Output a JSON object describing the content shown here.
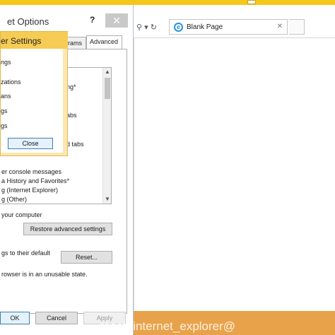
{
  "dialog": {
    "title": "et Options",
    "help": "?",
    "close": "✕",
    "tabs": [
      {
        "label": "grams"
      },
      {
        "label": "Advanced"
      }
    ],
    "settings_lines": [
      "ng*",
      "abs",
      "d tabs",
      "er console messages",
      "a History and Favorites*",
      "g (Internet Explorer)",
      "g (Other)"
    ],
    "restore_caption": "your computer",
    "restore_button": "Restore advanced settings",
    "reset_caption": "gs to their default",
    "reset_button": "Reset...",
    "unusable_note": "rowser is in an unusable state.",
    "ok": "OK",
    "cancel": "Cancel",
    "apply": "Apply"
  },
  "popup": {
    "title": "er Settings",
    "lines": [
      "ngs",
      "zations",
      "ans",
      "gs",
      "gs"
    ],
    "close_button": "Close"
  },
  "browser": {
    "nav_icons": "⚲ ▾ ↻",
    "tab_label": "Blank Page",
    "tab_close": "✕"
  },
  "watermark": "reset_internet_explorer@",
  "colors": {
    "accent": "#f5c71a",
    "popup_title": "#f6cc54",
    "taskbar": "#e8a24a"
  }
}
